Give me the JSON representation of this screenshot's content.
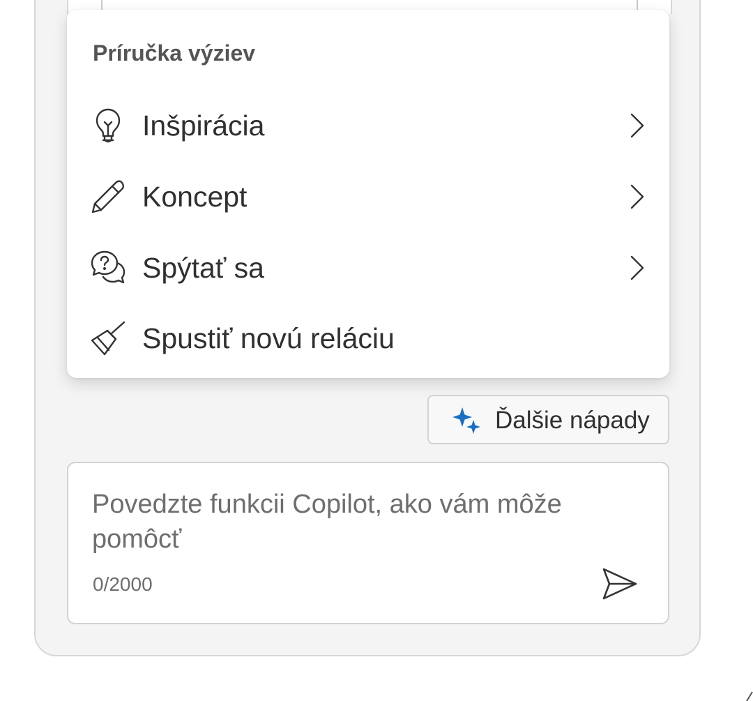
{
  "menu": {
    "heading": "Príručka výziev",
    "items": [
      {
        "label": "Inšpirácia",
        "icon": "lightbulb-icon",
        "has_submenu": true
      },
      {
        "label": "Koncept",
        "icon": "pencil-icon",
        "has_submenu": true
      },
      {
        "label": "Spýtať sa",
        "icon": "question-chat-icon",
        "has_submenu": true
      },
      {
        "label": "Spustiť novú reláciu",
        "icon": "broom-icon",
        "has_submenu": false
      }
    ]
  },
  "ideas_button": {
    "label": "Ďalšie nápady",
    "icon": "sparkle-icon",
    "icon_color": "#1a6fc4"
  },
  "composer": {
    "placeholder": "Povedzte funkcii Copilot, ako vám môže pomôcť",
    "value": "",
    "counter": "0/2000",
    "send_icon": "send-icon"
  },
  "colors": {
    "panel_bg": "#f4f4f4",
    "text": "#303030",
    "muted_text": "#6e6e6e",
    "accent": "#1a6fc4"
  }
}
